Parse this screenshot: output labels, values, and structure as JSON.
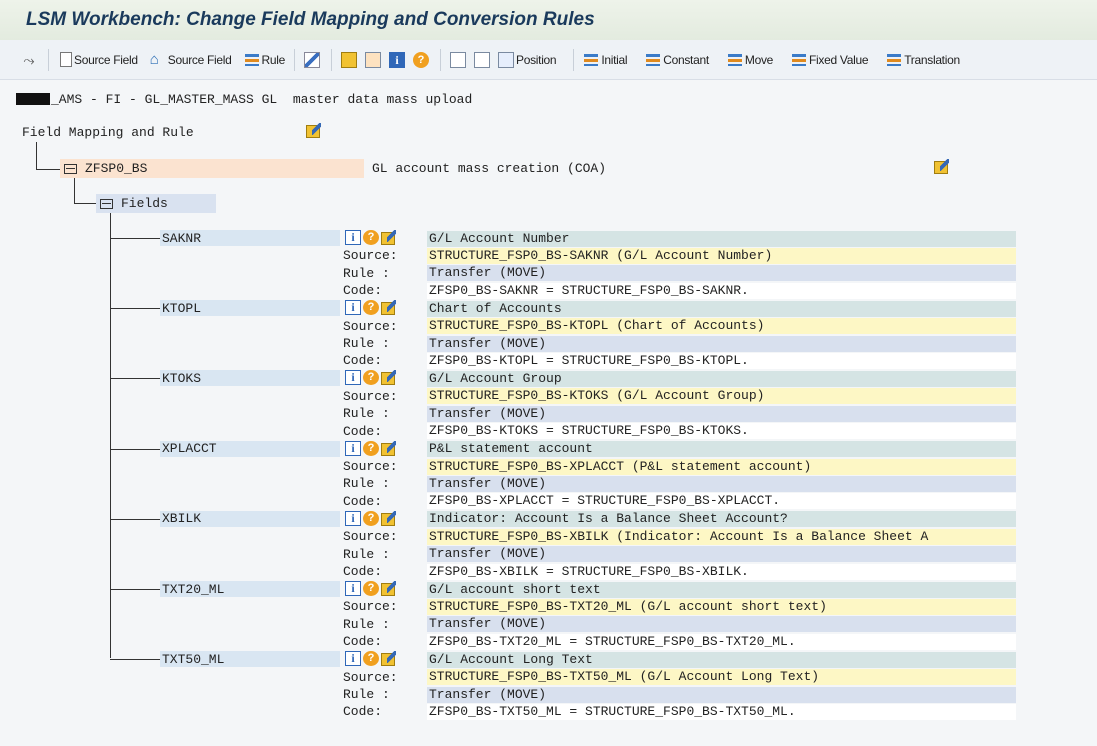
{
  "window": {
    "title": "LSM Workbench: Change Field Mapping and Conversion Rules"
  },
  "toolbar": {
    "items": [
      {
        "icon": "select-all-icon",
        "label": ""
      },
      {
        "icon": "new-document-icon",
        "label": "Source Field"
      },
      {
        "icon": "trash-icon",
        "label": "Source Field"
      },
      {
        "icon": "rule-icon",
        "label": "Rule"
      },
      {
        "icon": "edit-pencil-icon",
        "label": ""
      },
      {
        "icon": "copy-icon",
        "label": ""
      },
      {
        "icon": "layout-icon",
        "label": ""
      },
      {
        "icon": "info-icon",
        "label": ""
      },
      {
        "icon": "help-icon",
        "label": ""
      },
      {
        "icon": "expand-icon",
        "label": ""
      },
      {
        "icon": "collapse-icon",
        "label": ""
      },
      {
        "icon": "position-icon",
        "label": "Position"
      },
      {
        "icon": "rule-icon",
        "label": "Initial"
      },
      {
        "icon": "rule-icon",
        "label": "Constant"
      },
      {
        "icon": "rule-icon",
        "label": "Move"
      },
      {
        "icon": "rule-icon",
        "label": "Fixed Value"
      },
      {
        "icon": "rule-icon",
        "label": "Translation"
      }
    ]
  },
  "project": {
    "description": "_AMS - FI - GL_MASTER_MASS GL  master data mass upload"
  },
  "tree": {
    "root_label": "Field Mapping and Rule",
    "structure": {
      "name": "ZFSP0_BS",
      "description": "GL account mass creation (COA)"
    },
    "fields_label": "Fields",
    "row_labels": {
      "source": "Source:",
      "rule": "Rule :",
      "code": "Code:"
    },
    "fields": [
      {
        "name": "SAKNR",
        "description": "G/L Account Number",
        "source": "STRUCTURE_FSP0_BS-SAKNR (G/L Account Number)",
        "rule": "Transfer (MOVE)",
        "code": "ZFSP0_BS-SAKNR = STRUCTURE_FSP0_BS-SAKNR."
      },
      {
        "name": "KTOPL",
        "description": "Chart of Accounts",
        "source": "STRUCTURE_FSP0_BS-KTOPL (Chart of Accounts)",
        "rule": "Transfer (MOVE)",
        "code": "ZFSP0_BS-KTOPL = STRUCTURE_FSP0_BS-KTOPL."
      },
      {
        "name": "KTOKS",
        "description": "G/L Account Group",
        "source": "STRUCTURE_FSP0_BS-KTOKS (G/L Account Group)",
        "rule": "Transfer (MOVE)",
        "code": "ZFSP0_BS-KTOKS = STRUCTURE_FSP0_BS-KTOKS."
      },
      {
        "name": "XPLACCT",
        "description": "P&L statement account",
        "source": "STRUCTURE_FSP0_BS-XPLACCT (P&L statement account)",
        "rule": "Transfer (MOVE)",
        "code": "ZFSP0_BS-XPLACCT = STRUCTURE_FSP0_BS-XPLACCT."
      },
      {
        "name": "XBILK",
        "description": "Indicator: Account Is a Balance Sheet Account?",
        "source": "STRUCTURE_FSP0_BS-XBILK (Indicator: Account Is a Balance Sheet A",
        "rule": "Transfer (MOVE)",
        "code": "ZFSP0_BS-XBILK = STRUCTURE_FSP0_BS-XBILK."
      },
      {
        "name": "TXT20_ML",
        "description": "G/L account short text",
        "source": "STRUCTURE_FSP0_BS-TXT20_ML (G/L account short text)",
        "rule": "Transfer (MOVE)",
        "code": "ZFSP0_BS-TXT20_ML = STRUCTURE_FSP0_BS-TXT20_ML."
      },
      {
        "name": "TXT50_ML",
        "description": "G/L Account Long Text",
        "source": "STRUCTURE_FSP0_BS-TXT50_ML (G/L Account Long Text)",
        "rule": "Transfer (MOVE)",
        "code": "ZFSP0_BS-TXT50_ML = STRUCTURE_FSP0_BS-TXT50_ML."
      }
    ]
  },
  "colors": {
    "title": "#1a3a5c",
    "structure_highlight": "#fbe3d0",
    "fields_highlight": "#d9e2f0",
    "field_label_bg": "#d9e6f2",
    "header_row": "#d5e4e4",
    "source_row": "#fdf7c5",
    "rule_row": "#d8e0ee",
    "code_row": "#ffffff"
  }
}
